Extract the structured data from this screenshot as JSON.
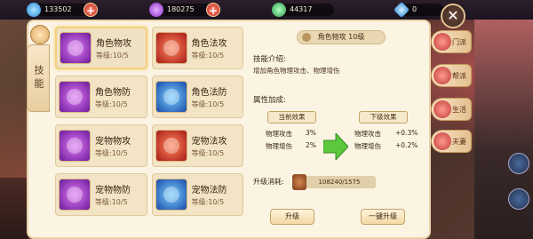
{
  "resources": [
    {
      "value": "133502",
      "color": "#4ab8ff"
    },
    {
      "value": "180275",
      "color": "#b86af5"
    },
    {
      "value": "44317",
      "color": "#4ac86a"
    },
    {
      "value": "0",
      "color": "#6ac0ff"
    }
  ],
  "side_tab": {
    "label": "技能"
  },
  "skills": [
    {
      "name": "角色物攻",
      "level": "等级:10/5",
      "color": "purple",
      "icon": "sword-icon",
      "selected": true
    },
    {
      "name": "角色法攻",
      "level": "等级:10/5",
      "color": "red",
      "icon": "fire-icon",
      "selected": false
    },
    {
      "name": "角色物防",
      "level": "等级:10/5",
      "color": "purple",
      "icon": "shield-icon",
      "selected": false
    },
    {
      "name": "角色法防",
      "level": "等级:10/5",
      "color": "blue",
      "icon": "magic-shield-icon",
      "selected": false
    },
    {
      "name": "宠物物攻",
      "level": "等级:10/5",
      "color": "purple",
      "icon": "pet-attack-icon",
      "selected": false
    },
    {
      "name": "宠物法攻",
      "level": "等级:10/5",
      "color": "red",
      "icon": "pet-fire-icon",
      "selected": false
    },
    {
      "name": "宠物物防",
      "level": "等级:10/5",
      "color": "purple",
      "icon": "pet-shield-icon",
      "selected": false
    },
    {
      "name": "宠物法防",
      "level": "等级:10/5",
      "color": "blue",
      "icon": "pet-magic-shield-icon",
      "selected": false
    }
  ],
  "detail": {
    "title": "角色物攻  10级",
    "intro_heading": "技能介绍:",
    "intro_text": "增加角色物理攻击、物理增伤",
    "attr_heading": "属性加成:",
    "current_label": "当前效果",
    "next_label": "下级效果",
    "current_rows": [
      {
        "name": "物理攻击",
        "value": "3%"
      },
      {
        "name": "物理增伤",
        "value": "2%"
      }
    ],
    "next_rows": [
      {
        "name": "物理攻击",
        "value": "+0.3%"
      },
      {
        "name": "物理增伤",
        "value": "+0.2%"
      }
    ],
    "cost_label": "升级消耗:",
    "cost_value": "108240/1575",
    "upgrade_button": "升级",
    "upgrade_all_button": "一键升级"
  },
  "right_menu": [
    {
      "label": "门派",
      "active": false
    },
    {
      "label": "帮派",
      "active": false
    },
    {
      "label": "生活",
      "active": false
    },
    {
      "label": "夫妻",
      "active": false
    }
  ],
  "close_label": "✕"
}
